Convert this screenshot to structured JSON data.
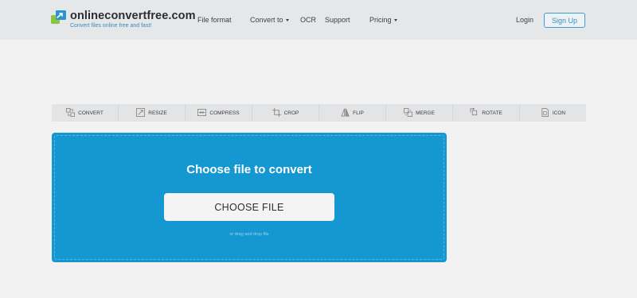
{
  "header": {
    "logo_name": "onlineconvertfree.com",
    "logo_tagline": "Convert files online free and fast!",
    "nav": {
      "file_format": "File format",
      "convert_to": "Convert to",
      "ocr": "OCR",
      "support": "Support",
      "pricing": "Pricing"
    },
    "login": "Login",
    "signup": "Sign Up",
    "accent_color": "#3aa0cf"
  },
  "tools": [
    {
      "label": "CONVERT",
      "icon": "convert-icon"
    },
    {
      "label": "RESIZE",
      "icon": "resize-icon"
    },
    {
      "label": "COMPRESS",
      "icon": "compress-icon"
    },
    {
      "label": "CROP",
      "icon": "crop-icon"
    },
    {
      "label": "FLIP",
      "icon": "flip-icon"
    },
    {
      "label": "MERGE",
      "icon": "merge-icon"
    },
    {
      "label": "ROTATE",
      "icon": "rotate-icon"
    },
    {
      "label": "ICON",
      "icon": "icon-icon"
    }
  ],
  "upload": {
    "title": "Choose file to convert",
    "button": "CHOOSE FILE",
    "drag_hint": "or drag and drop file",
    "background_color": "#1597d1"
  }
}
